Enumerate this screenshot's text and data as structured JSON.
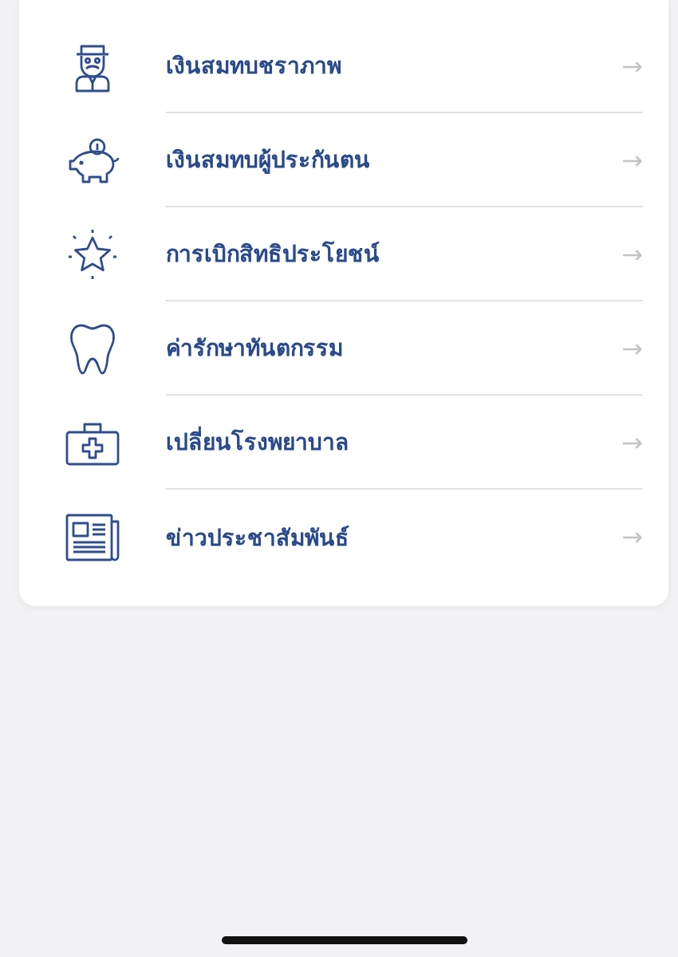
{
  "menu": [
    {
      "label": "เงินสมทบชราภาพ",
      "arrow": "→"
    },
    {
      "label": "เงินสมทบผู้ประกันตน",
      "arrow": "→"
    },
    {
      "label": "การเบิกสิทธิประโยชน์",
      "arrow": "→"
    },
    {
      "label": "ค่ารักษาทันตกรรม",
      "arrow": "→"
    },
    {
      "label": "เปลี่ยนโรงพยาบาล",
      "arrow": "→"
    },
    {
      "label": "ข่าวประชาสัมพันธ์",
      "arrow": "→"
    }
  ]
}
